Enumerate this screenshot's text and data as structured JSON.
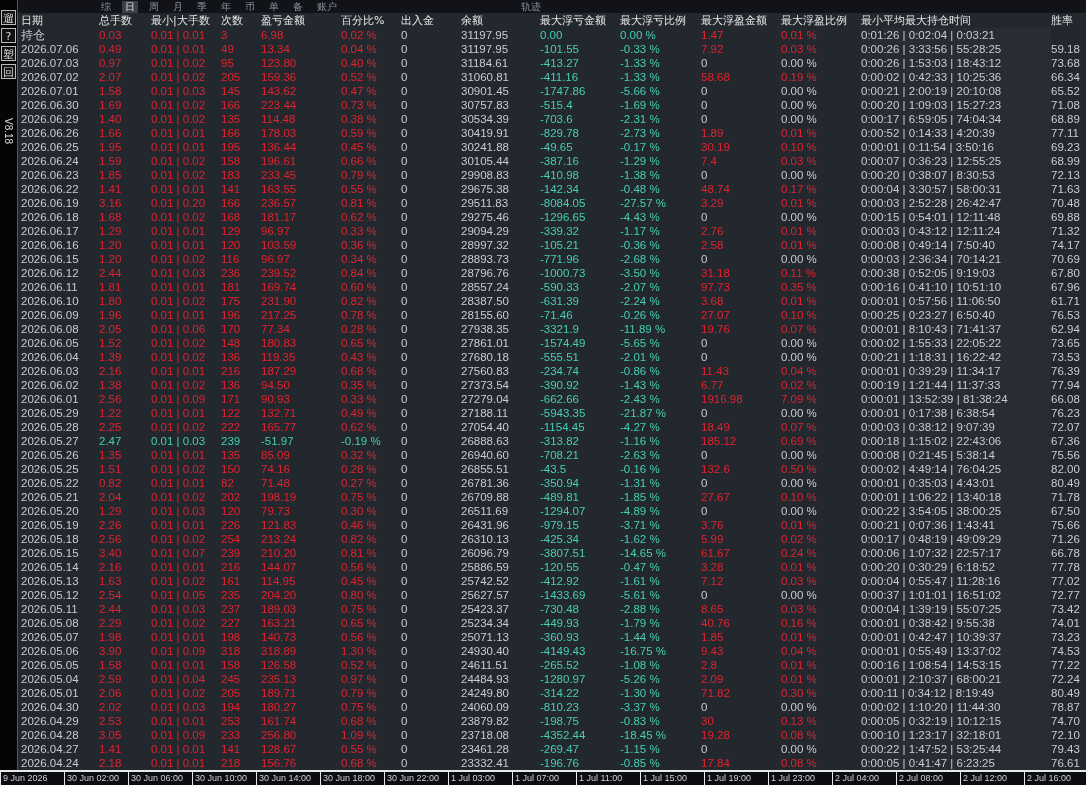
{
  "tabs": [
    {
      "label": "综",
      "selected": false
    },
    {
      "label": "日",
      "selected": true
    },
    {
      "label": "周",
      "selected": false
    },
    {
      "label": "月",
      "selected": false
    },
    {
      "label": "季",
      "selected": false
    },
    {
      "label": "年",
      "selected": false
    },
    {
      "label": "币",
      "selected": false
    },
    {
      "label": "单",
      "selected": false
    },
    {
      "label": "备",
      "selected": false
    },
    {
      "label": "账户",
      "selected": false
    },
    {
      "label": "轨迹",
      "selected": false
    }
  ],
  "side_buttons": [
    "遛",
    "?",
    "塑",
    "回"
  ],
  "version": "V8.18",
  "table": {
    "columns": [
      "日期",
      "总手数",
      "最小|大手数",
      "次数",
      "盈亏金额",
      "百分比%",
      "出入金",
      "余额",
      "最大浮亏金额",
      "最大浮亏比例",
      "最大浮盈金额",
      "最大浮盈比例",
      "最小平均最大持仓时间",
      "胜率"
    ],
    "rows": [
      {
        "cells": [
          "持仓",
          "0.03",
          "0.01 | 0.01",
          "3",
          "6.98",
          "0.02 %",
          "0",
          "31197.95",
          "0.00",
          "0.00 %",
          "1.47",
          "0.01 %",
          "0:01:26 | 0:02:04 | 0:03:21"
        ],
        "loss": false,
        "peak_highlighted": true
      },
      {
        "cells": [
          "2026.07.06",
          "0.49",
          "0.01 | 0.01",
          "49",
          "13.34",
          "0.04 %",
          "0",
          "31197.95",
          "-101.55",
          "-0.33 %",
          "7.92",
          "0.03 %",
          "0:00:26 | 3:33:56 | 55:28:25",
          "59.18"
        ],
        "loss": false,
        "peak_highlighted": true
      },
      {
        "cells": [
          "2026.07.03",
          "0.97",
          "0.01 | 0.02",
          "95",
          "123.80",
          "0.40 %",
          "0",
          "31184.61",
          "-413.27",
          "-1.33 %",
          "0",
          "0.00 %",
          "0:00:26 | 1:53:03 | 18:43:12",
          "73.68"
        ],
        "loss": false,
        "peak_highlighted": false
      },
      {
        "cells": [
          "2026.07.02",
          "2.07",
          "0.01 | 0.02",
          "205",
          "159.36",
          "0.52 %",
          "0",
          "31060.81",
          "-411.16",
          "-1.33 %",
          "58.68",
          "0.19 %",
          "0:00:02 | 0:42:33 | 10:25:36",
          "66.34"
        ],
        "loss": false,
        "peak_highlighted": true
      },
      {
        "cells": [
          "2026.07.01",
          "1.58",
          "0.01 | 0.03",
          "145",
          "143.62",
          "0.47 %",
          "0",
          "30901.45",
          "-1747.86",
          "-5.66 %",
          "0",
          "0.00 %",
          "0:00:21 | 2:00:19 | 20:10:08",
          "65.52"
        ],
        "loss": false,
        "peak_highlighted": false
      },
      {
        "cells": [
          "2026.06.30",
          "1.69",
          "0.01 | 0.02",
          "166",
          "223.44",
          "0.73 %",
          "0",
          "30757.83",
          "-515.4",
          "-1.69 %",
          "0",
          "0.00 %",
          "0:00:20 | 1:09:03 | 15:27:23",
          "71.08"
        ],
        "loss": false,
        "peak_highlighted": false
      },
      {
        "cells": [
          "2026.06.29",
          "1.40",
          "0.01 | 0.02",
          "135",
          "114.48",
          "0.38 %",
          "0",
          "30534.39",
          "-703.6",
          "-2.31 %",
          "0",
          "0.00 %",
          "0:00:17 | 6:59:05 | 74:04:34",
          "68.89"
        ],
        "loss": false,
        "peak_highlighted": false
      },
      {
        "cells": [
          "2026.06.26",
          "1.66",
          "0.01 | 0.01",
          "166",
          "178.03",
          "0.59 %",
          "0",
          "30419.91",
          "-829.78",
          "-2.73 %",
          "1.89",
          "0.01 %",
          "0:00:52 | 0:14:33 | 4:20:39",
          "77.11"
        ],
        "loss": false,
        "peak_highlighted": true
      },
      {
        "cells": [
          "2026.06.25",
          "1.95",
          "0.01 | 0.01",
          "195",
          "136.44",
          "0.45 %",
          "0",
          "30241.88",
          "-49.65",
          "-0.17 %",
          "30.19",
          "0.10 %",
          "0:00:01 | 0:11:54 | 3:50:16",
          "69.23"
        ],
        "loss": false,
        "peak_highlighted": true
      },
      {
        "cells": [
          "2026.06.24",
          "1.59",
          "0.01 | 0.02",
          "158",
          "196.61",
          "0.66 %",
          "0",
          "30105.44",
          "-387.16",
          "-1.29 %",
          "7.4",
          "0.03 %",
          "0:00:07 | 0:36:23 | 12:55:25",
          "68.99"
        ],
        "loss": false,
        "peak_highlighted": true
      },
      {
        "cells": [
          "2026.06.23",
          "1.85",
          "0.01 | 0.02",
          "183",
          "233.45",
          "0.79 %",
          "0",
          "29908.83",
          "-410.98",
          "-1.38 %",
          "0",
          "0.00 %",
          "0:00:20 | 0:38:07 | 8:30:53",
          "72.13"
        ],
        "loss": false,
        "peak_highlighted": false
      },
      {
        "cells": [
          "2026.06.22",
          "1.41",
          "0.01 | 0.01",
          "141",
          "163.55",
          "0.55 %",
          "0",
          "29675.38",
          "-142.34",
          "-0.48 %",
          "48.74",
          "0.17 %",
          "0:00:04 | 3:30:57 | 58:00:31",
          "71.63"
        ],
        "loss": false,
        "peak_highlighted": true
      },
      {
        "cells": [
          "2026.06.19",
          "3.16",
          "0.01 | 0.20",
          "166",
          "236.57",
          "0.81 %",
          "0",
          "29511.83",
          "-8084.05",
          "-27.57 %",
          "3.29",
          "0.01 %",
          "0:00:03 | 2:52:28 | 26:42:47",
          "70.48"
        ],
        "loss": false,
        "peak_highlighted": true
      },
      {
        "cells": [
          "2026.06.18",
          "1.68",
          "0.01 | 0.02",
          "168",
          "181.17",
          "0.62 %",
          "0",
          "29275.46",
          "-1296.65",
          "-4.43 %",
          "0",
          "0.00 %",
          "0:00:15 | 0:54:01 | 12:11:48",
          "69.88"
        ],
        "loss": false,
        "peak_highlighted": false
      },
      {
        "cells": [
          "2026.06.17",
          "1.29",
          "0.01 | 0.01",
          "129",
          "96.97",
          "0.33 %",
          "0",
          "29094.29",
          "-339.32",
          "-1.17 %",
          "2.76",
          "0.01 %",
          "0:00:03 | 0:43:12 | 12:11:24",
          "71.32"
        ],
        "loss": false,
        "peak_highlighted": true
      },
      {
        "cells": [
          "2026.06.16",
          "1.20",
          "0.01 | 0.01",
          "120",
          "103.59",
          "0.36 %",
          "0",
          "28997.32",
          "-105.21",
          "-0.36 %",
          "2.58",
          "0.01 %",
          "0:00:08 | 0:49:14 | 7:50:40",
          "74.17"
        ],
        "loss": false,
        "peak_highlighted": true
      },
      {
        "cells": [
          "2026.06.15",
          "1.20",
          "0.01 | 0.02",
          "116",
          "96.97",
          "0.34 %",
          "0",
          "28893.73",
          "-771.96",
          "-2.68 %",
          "0",
          "0.00 %",
          "0:00:03 | 2:36:34 | 70:14:21",
          "70.69"
        ],
        "loss": false,
        "peak_highlighted": false
      },
      {
        "cells": [
          "2026.06.12",
          "2.44",
          "0.01 | 0.03",
          "236",
          "239.52",
          "0.84 %",
          "0",
          "28796.76",
          "-1000.73",
          "-3.50 %",
          "31.18",
          "0.11 %",
          "0:00:38 | 0:52:05 | 9:19:03",
          "67.80"
        ],
        "loss": false,
        "peak_highlighted": true
      },
      {
        "cells": [
          "2026.06.11",
          "1.81",
          "0.01 | 0.01",
          "181",
          "169.74",
          "0.60 %",
          "0",
          "28557.24",
          "-590.33",
          "-2.07 %",
          "97.73",
          "0.35 %",
          "0:00:16 | 0:41:10 | 10:51:10",
          "67.96"
        ],
        "loss": false,
        "peak_highlighted": true
      },
      {
        "cells": [
          "2026.06.10",
          "1.80",
          "0.01 | 0.02",
          "175",
          "231.90",
          "0.82 %",
          "0",
          "28387.50",
          "-631.39",
          "-2.24 %",
          "3.68",
          "0.01 %",
          "0:00:01 | 0:57:56 | 11:06:50",
          "61.71"
        ],
        "loss": false,
        "peak_highlighted": true
      },
      {
        "cells": [
          "2026.06.09",
          "1.96",
          "0.01 | 0.01",
          "196",
          "217.25",
          "0.78 %",
          "0",
          "28155.60",
          "-71.46",
          "-0.26 %",
          "27.07",
          "0.10 %",
          "0:00:25 | 0:23:27 | 6:50:40",
          "76.53"
        ],
        "loss": false,
        "peak_highlighted": true
      },
      {
        "cells": [
          "2026.06.08",
          "2.05",
          "0.01 | 0.06",
          "170",
          "77.34",
          "0.28 %",
          "0",
          "27938.35",
          "-3321.9",
          "-11.89 %",
          "19.76",
          "0.07 %",
          "0:00:01 | 8:10:43 | 71:41:37",
          "62.94"
        ],
        "loss": false,
        "peak_highlighted": true
      },
      {
        "cells": [
          "2026.06.05",
          "1.52",
          "0.01 | 0.02",
          "148",
          "180.83",
          "0.65 %",
          "0",
          "27861.01",
          "-1574.49",
          "-5.65 %",
          "0",
          "0.00 %",
          "0:00:02 | 1:55:33 | 22:05:22",
          "73.65"
        ],
        "loss": false,
        "peak_highlighted": false
      },
      {
        "cells": [
          "2026.06.04",
          "1.39",
          "0.01 | 0.02",
          "136",
          "119.35",
          "0.43 %",
          "0",
          "27680.18",
          "-555.51",
          "-2.01 %",
          "0",
          "0.00 %",
          "0:00:21 | 1:18:31 | 16:22:42",
          "73.53"
        ],
        "loss": false,
        "peak_highlighted": false
      },
      {
        "cells": [
          "2026.06.03",
          "2.16",
          "0.01 | 0.01",
          "216",
          "187.29",
          "0.68 %",
          "0",
          "27560.83",
          "-234.74",
          "-0.86 %",
          "11.43",
          "0.04 %",
          "0:00:01 | 0:39:29 | 11:34:17",
          "76.39"
        ],
        "loss": false,
        "peak_highlighted": true
      },
      {
        "cells": [
          "2026.06.02",
          "1.38",
          "0.01 | 0.02",
          "136",
          "94.50",
          "0.35 %",
          "0",
          "27373.54",
          "-390.92",
          "-1.43 %",
          "6.77",
          "0.02 %",
          "0:00:19 | 1:21:44 | 11:37:33",
          "77.94"
        ],
        "loss": false,
        "peak_highlighted": true
      },
      {
        "cells": [
          "2026.06.01",
          "2.56",
          "0.01 | 0.09",
          "171",
          "90.93",
          "0.33 %",
          "0",
          "27279.04",
          "-662.66",
          "-2.43 %",
          "1916.98",
          "7.09 %",
          "0:00:01 | 13:52:39 | 81:38:24",
          "66.08"
        ],
        "loss": false,
        "peak_highlighted": true
      },
      {
        "cells": [
          "2026.05.29",
          "1.22",
          "0.01 | 0.01",
          "122",
          "132.71",
          "0.49 %",
          "0",
          "27188.11",
          "-5943.35",
          "-21.87 %",
          "0",
          "0.00 %",
          "0:00:01 | 0:17:38 | 6:38:54",
          "76.23"
        ],
        "loss": false,
        "peak_highlighted": false
      },
      {
        "cells": [
          "2026.05.28",
          "2.25",
          "0.01 | 0.02",
          "222",
          "165.77",
          "0.62 %",
          "0",
          "27054.40",
          "-1154.45",
          "-4.27 %",
          "18.49",
          "0.07 %",
          "0:00:03 | 0:38:12 | 9:07:39",
          "72.07"
        ],
        "loss": false,
        "peak_highlighted": true
      },
      {
        "cells": [
          "2026.05.27",
          "2.47",
          "0.01 | 0.03",
          "239",
          "-51.97",
          "-0.19 %",
          "0",
          "26888.63",
          "-313.82",
          "-1.16 %",
          "185.12",
          "0.69 %",
          "0:00:18 | 1:15:02 | 22:43:06",
          "67.36"
        ],
        "loss": true,
        "peak_highlighted": true
      },
      {
        "cells": [
          "2026.05.26",
          "1.35",
          "0.01 | 0.01",
          "135",
          "85.09",
          "0.32 %",
          "0",
          "26940.60",
          "-708.21",
          "-2.63 %",
          "0",
          "0.00 %",
          "0:00:08 | 0:21:45 | 5:38:14",
          "75.56"
        ],
        "loss": false,
        "peak_highlighted": false
      },
      {
        "cells": [
          "2026.05.25",
          "1.51",
          "0.01 | 0.02",
          "150",
          "74.16",
          "0.28 %",
          "0",
          "26855.51",
          "-43.5",
          "-0.16 %",
          "132.6",
          "0.50 %",
          "0:00:02 | 4:49:14 | 76:04:25",
          "82.00"
        ],
        "loss": false,
        "peak_highlighted": true
      },
      {
        "cells": [
          "2026.05.22",
          "0.82",
          "0.01 | 0.01",
          "82",
          "71.48",
          "0.27 %",
          "0",
          "26781.36",
          "-350.94",
          "-1.31 %",
          "0",
          "0.00 %",
          "0:00:01 | 0:35:03 | 4:43:01",
          "80.49"
        ],
        "loss": false,
        "peak_highlighted": false
      },
      {
        "cells": [
          "2026.05.21",
          "2.04",
          "0.01 | 0.02",
          "202",
          "198.19",
          "0.75 %",
          "0",
          "26709.88",
          "-489.81",
          "-1.85 %",
          "27.67",
          "0.10 %",
          "0:00:01 | 1:06:22 | 13:40:18",
          "71.78"
        ],
        "loss": false,
        "peak_highlighted": true
      },
      {
        "cells": [
          "2026.05.20",
          "1.29",
          "0.01 | 0.03",
          "120",
          "79.73",
          "0.30 %",
          "0",
          "26511.69",
          "-1294.07",
          "-4.89 %",
          "0",
          "0.00 %",
          "0:00:22 | 3:54:05 | 38:00:25",
          "67.50"
        ],
        "loss": false,
        "peak_highlighted": false
      },
      {
        "cells": [
          "2026.05.19",
          "2.26",
          "0.01 | 0.01",
          "226",
          "121.83",
          "0.46 %",
          "0",
          "26431.96",
          "-979.15",
          "-3.71 %",
          "3.76",
          "0.01 %",
          "0:00:21 | 0:07:36 | 1:43:41",
          "75.66"
        ],
        "loss": false,
        "peak_highlighted": true
      },
      {
        "cells": [
          "2026.05.18",
          "2.56",
          "0.01 | 0.02",
          "254",
          "213.24",
          "0.82 %",
          "0",
          "26310.13",
          "-425.34",
          "-1.62 %",
          "5.99",
          "0.02 %",
          "0:00:17 | 0:48:19 | 49:09:29",
          "71.26"
        ],
        "loss": false,
        "peak_highlighted": true
      },
      {
        "cells": [
          "2026.05.15",
          "3.40",
          "0.01 | 0.07",
          "239",
          "210.20",
          "0.81 %",
          "0",
          "26096.79",
          "-3807.51",
          "-14.65 %",
          "61.67",
          "0.24 %",
          "0:00:06 | 1:07:32 | 22:57:17",
          "66.78"
        ],
        "loss": false,
        "peak_highlighted": true
      },
      {
        "cells": [
          "2026.05.14",
          "2.16",
          "0.01 | 0.01",
          "216",
          "144.07",
          "0.56 %",
          "0",
          "25886.59",
          "-120.55",
          "-0.47 %",
          "3.28",
          "0.01 %",
          "0:00:20 | 0:30:29 | 6:18:52",
          "77.78"
        ],
        "loss": false,
        "peak_highlighted": true
      },
      {
        "cells": [
          "2026.05.13",
          "1.63",
          "0.01 | 0.02",
          "161",
          "114.95",
          "0.45 %",
          "0",
          "25742.52",
          "-412.92",
          "-1.61 %",
          "7.12",
          "0.03 %",
          "0:00:04 | 0:55:47 | 11:28:16",
          "77.02"
        ],
        "loss": false,
        "peak_highlighted": true
      },
      {
        "cells": [
          "2026.05.12",
          "2.54",
          "0.01 | 0.05",
          "235",
          "204.20",
          "0.80 %",
          "0",
          "25627.57",
          "-1433.69",
          "-5.61 %",
          "0",
          "0.00 %",
          "0:00:37 | 1:01:01 | 16:51:02",
          "72.77"
        ],
        "loss": false,
        "peak_highlighted": false
      },
      {
        "cells": [
          "2026.05.11",
          "2.44",
          "0.01 | 0.03",
          "237",
          "189.03",
          "0.75 %",
          "0",
          "25423.37",
          "-730.48",
          "-2.88 %",
          "8.65",
          "0.03 %",
          "0:00:04 | 1:39:19 | 55:07:25",
          "73.42"
        ],
        "loss": false,
        "peak_highlighted": true
      },
      {
        "cells": [
          "2026.05.08",
          "2.29",
          "0.01 | 0.02",
          "227",
          "163.21",
          "0.65 %",
          "0",
          "25234.34",
          "-449.93",
          "-1.79 %",
          "40.76",
          "0.16 %",
          "0:00:01 | 0:38:42 | 9:55:38",
          "74.01"
        ],
        "loss": false,
        "peak_highlighted": true
      },
      {
        "cells": [
          "2026.05.07",
          "1.98",
          "0.01 | 0.01",
          "198",
          "140.73",
          "0.56 %",
          "0",
          "25071.13",
          "-360.93",
          "-1.44 %",
          "1.85",
          "0.01 %",
          "0:00:01 | 0:42:47 | 10:39:37",
          "73.23"
        ],
        "loss": false,
        "peak_highlighted": true
      },
      {
        "cells": [
          "2026.05.06",
          "3.90",
          "0.01 | 0.09",
          "318",
          "318.89",
          "1.30 %",
          "0",
          "24930.40",
          "-4149.43",
          "-16.75 %",
          "9.43",
          "0.04 %",
          "0:00:01 | 0:55:49 | 13:37:02",
          "74.53"
        ],
        "loss": false,
        "peak_highlighted": true
      },
      {
        "cells": [
          "2026.05.05",
          "1.58",
          "0.01 | 0.01",
          "158",
          "126.58",
          "0.52 %",
          "0",
          "24611.51",
          "-265.52",
          "-1.08 %",
          "2.8",
          "0.01 %",
          "0:00:16 | 1:08:54 | 14:53:15",
          "77.22"
        ],
        "loss": false,
        "peak_highlighted": true
      },
      {
        "cells": [
          "2026.05.04",
          "2.59",
          "0.01 | 0.04",
          "245",
          "235.13",
          "0.97 %",
          "0",
          "24484.93",
          "-1280.97",
          "-5.26 %",
          "2.09",
          "0.01 %",
          "0:00:01 | 2:10:37 | 68:00:21",
          "72.24"
        ],
        "loss": false,
        "peak_highlighted": true
      },
      {
        "cells": [
          "2026.05.01",
          "2.06",
          "0.01 | 0.02",
          "205",
          "189.71",
          "0.79 %",
          "0",
          "24249.80",
          "-314.22",
          "-1.30 %",
          "71.82",
          "0.30 %",
          "0:00:11 | 0:34:12 | 8:19:49",
          "80.49"
        ],
        "loss": false,
        "peak_highlighted": true
      },
      {
        "cells": [
          "2026.04.30",
          "2.02",
          "0.01 | 0.03",
          "194",
          "180.27",
          "0.75 %",
          "0",
          "24060.09",
          "-810.23",
          "-3.37 %",
          "0",
          "0.00 %",
          "0:00:02 | 1:10:20 | 11:44:30",
          "78.87"
        ],
        "loss": false,
        "peak_highlighted": false
      },
      {
        "cells": [
          "2026.04.29",
          "2.53",
          "0.01 | 0.01",
          "253",
          "161.74",
          "0.68 %",
          "0",
          "23879.82",
          "-198.75",
          "-0.83 %",
          "30",
          "0.13 %",
          "0:00:05 | 0:32:19 | 10:12:15",
          "74.70"
        ],
        "loss": false,
        "peak_highlighted": true
      },
      {
        "cells": [
          "2026.04.28",
          "3.05",
          "0.01 | 0.09",
          "233",
          "256.80",
          "1.09 %",
          "0",
          "23718.08",
          "-4352.44",
          "-18.45 %",
          "19.28",
          "0.08 %",
          "0:00:10 | 1:23:17 | 32:18:01",
          "72.10"
        ],
        "loss": false,
        "peak_highlighted": true
      },
      {
        "cells": [
          "2026.04.27",
          "1.41",
          "0.01 | 0.01",
          "141",
          "128.67",
          "0.55 %",
          "0",
          "23461.28",
          "-269.47",
          "-1.15 %",
          "0",
          "0.00 %",
          "0:00:22 | 1:47:52 | 53:25:44",
          "79.43"
        ],
        "loss": false,
        "peak_highlighted": false
      },
      {
        "cells": [
          "2026.04.24",
          "2.18",
          "0.01 | 0.01",
          "218",
          "156.76",
          "0.68 %",
          "0",
          "23332.41",
          "-196.76",
          "-0.85 %",
          "17.84",
          "0.08 %",
          "0:00:05 | 0:41:47 | 6:23:25",
          "76.61"
        ],
        "loss": false,
        "peak_highlighted": true
      }
    ]
  },
  "time_axis": [
    "9 Jun 2026",
    "30 Jun 02:00",
    "30 Jun 06:00",
    "30 Jun 10:00",
    "30 Jun 14:00",
    "30 Jun 18:00",
    "30 Jun 22:00",
    "1 Jul 03:00",
    "1 Jul 07:00",
    "1 Jul 11:00",
    "1 Jul 15:00",
    "1 Jul 19:00",
    "1 Jul 23:00",
    "2 Jul 04:00",
    "2 Jul 08:00",
    "2 Jul 12:00",
    "2 Jul 16:00"
  ]
}
